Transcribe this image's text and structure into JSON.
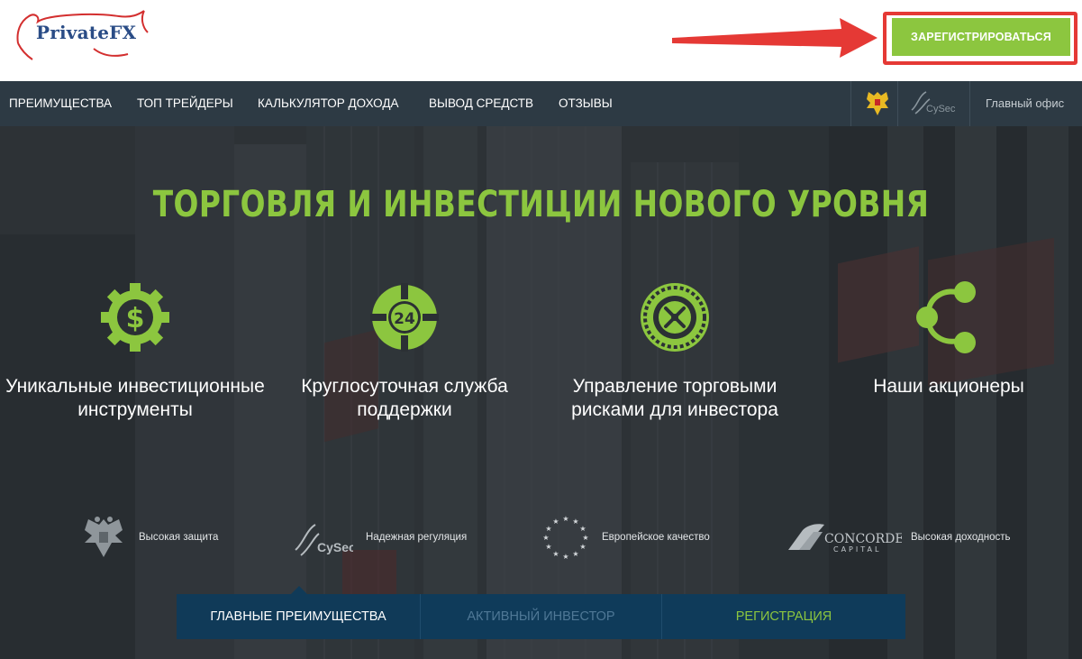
{
  "header": {
    "logo_text": "PrivateFX",
    "register_button": "ЗАРЕГИСТРИРОВАТЬСЯ",
    "colors": {
      "accent_green": "#8cc63f",
      "highlight_red": "#e53935",
      "logo_blue": "#2a4c86"
    }
  },
  "nav": {
    "items": [
      {
        "label": "ПРЕИМУЩЕСТВА"
      },
      {
        "label": "ТОП ТРЕЙДЕРЫ"
      },
      {
        "label": "КАЛЬКУЛЯТОР ДОХОДА"
      },
      {
        "label": "ВЫВОД СРЕДСТВ"
      },
      {
        "label": "ОТЗЫВЫ"
      }
    ],
    "cysec_label": "CySec",
    "office_link": "Главный офис"
  },
  "hero": {
    "title": "ТОРГОВЛЯ И ИНВЕСТИЦИИ НОВОГО УРОВНЯ",
    "features": [
      {
        "icon": "dollar-gear-icon",
        "label": "Уникальные инвестиционные инструменты"
      },
      {
        "icon": "lifebuoy-24-icon",
        "badge_number": "24",
        "label": "Круглосуточная служба поддержки"
      },
      {
        "icon": "roulette-icon",
        "label": "Управление торговыми рисками для инвестора"
      },
      {
        "icon": "share-network-icon",
        "label": "Наши акционеры"
      }
    ],
    "badges": [
      {
        "icon": "russian-eagle-icon",
        "label": "Высокая защита"
      },
      {
        "icon": "cysec-logo-icon",
        "logo_text": "CySec",
        "label": "Надежная регуляция"
      },
      {
        "icon": "eu-stars-icon",
        "label": "Европейское качество"
      },
      {
        "icon": "concorde-logo-icon",
        "logo_text": "CONCORDE",
        "logo_subtext": "CAPITAL",
        "label": "Высокая доходность"
      }
    ]
  },
  "tabs": [
    {
      "label": "ГЛАВНЫЕ ПРЕИМУЩЕСТВА",
      "active": true
    },
    {
      "label": "АКТИВНЫЙ ИНВЕСТОР",
      "active": false
    },
    {
      "label": "РЕГИСТРАЦИЯ",
      "active": false
    }
  ]
}
